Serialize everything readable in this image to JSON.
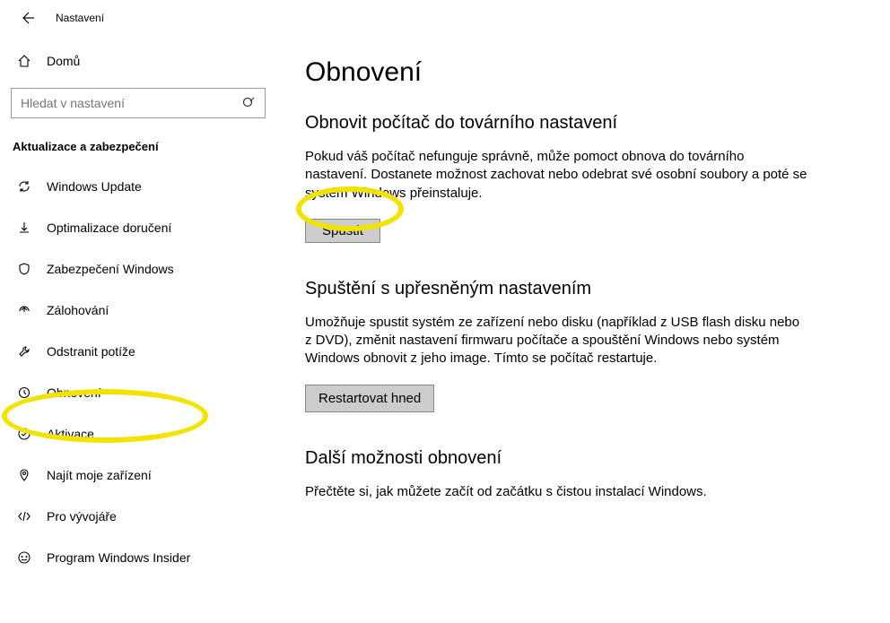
{
  "window": {
    "title": "Nastavení"
  },
  "sidebar": {
    "home": "Domů",
    "search_placeholder": "Hledat v nastavení",
    "section_label": "Aktualizace a zabezpečení",
    "items": [
      {
        "label": "Windows Update",
        "icon": "sync-icon"
      },
      {
        "label": "Optimalizace doručení",
        "icon": "delivery-icon"
      },
      {
        "label": "Zabezpečení Windows",
        "icon": "shield-icon"
      },
      {
        "label": "Zálohování",
        "icon": "backup-icon"
      },
      {
        "label": "Odstranit potíže",
        "icon": "troubleshoot-icon"
      },
      {
        "label": "Obnovení",
        "icon": "recovery-icon"
      },
      {
        "label": "Aktivace",
        "icon": "activation-icon"
      },
      {
        "label": "Najít moje zařízení",
        "icon": "find-device-icon"
      },
      {
        "label": "Pro vývojáře",
        "icon": "developer-icon"
      },
      {
        "label": "Program Windows Insider",
        "icon": "insider-icon"
      }
    ],
    "selected_index": 5
  },
  "main": {
    "heading": "Obnovení",
    "sections": [
      {
        "title": "Obnovit počítač do továrního nastavení",
        "text": "Pokud váš počítač nefunguje správně, může pomoct obnova do továrního nastavení. Dostanete možnost zachovat nebo odebrat své osobní soubory a poté se systém Windows přeinstaluje.",
        "button": "Spustit"
      },
      {
        "title": "Spuštění s upřesněným nastavením",
        "text": "Umožňuje spustit systém ze zařízení nebo disku (například z USB flash disku nebo z DVD), změnit nastavení firmwaru počítače a spouštění Windows nebo systém Windows obnovit z jeho image. Tímto se počítač restartuje.",
        "button": "Restartovat hned"
      },
      {
        "title": "Další možnosti obnovení",
        "text": "Přečtěte si, jak můžete začít od začátku s čistou instalací Windows."
      }
    ]
  }
}
